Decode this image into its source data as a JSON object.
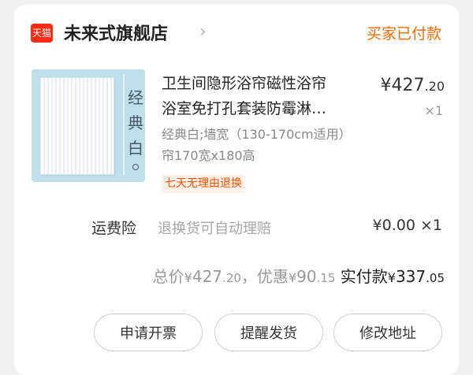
{
  "shop": {
    "platform_badge": "天猫",
    "name": "未来式旗舰店",
    "chevron": "›",
    "status": "买家已付款"
  },
  "product": {
    "image_caption": "经典白",
    "title_line1": "卫生间隐形浴帘磁性浴帘",
    "title_line2": "浴室免打孔套装防霉淋…",
    "price_int": "¥427",
    "price_dec": ".20",
    "quantity": "×1",
    "sku": "经典白;墙宽（130-170cm适用）帘170宽x180高",
    "return_policy": "七天无理由退换"
  },
  "insurance": {
    "label": "运费险",
    "desc": "退换货可自动理赔",
    "price": "¥0.00 ×1"
  },
  "totals": {
    "total_label": "总价",
    "total_yen": "¥",
    "total_int": "427",
    "total_dec": ".20",
    "discount_label": "，优惠",
    "discount_yen": "¥",
    "discount_int": "90",
    "discount_dec": ".15",
    "paid_label": " 实付款",
    "paid_yen": "¥",
    "paid_int": "337",
    "paid_dec": ".05"
  },
  "actions": {
    "invoice": "申请开票",
    "remind": "提醒发货",
    "address": "修改地址"
  },
  "colors": {
    "accent": "#ff6a00",
    "tmall_red": "#ff2a14",
    "badge_text": "#ff5000"
  }
}
